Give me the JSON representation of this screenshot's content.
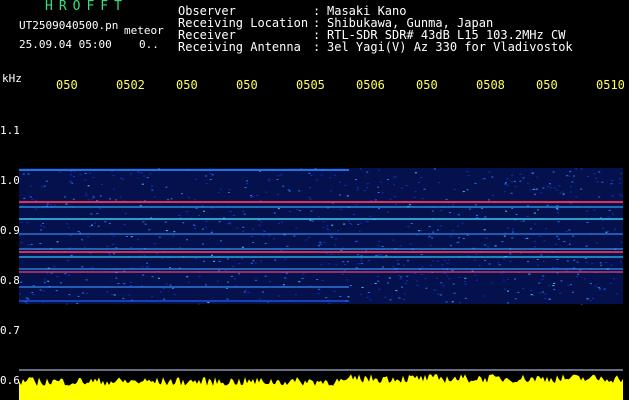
{
  "header": {
    "title": "HROFFT",
    "filename": "UT2509040500.pn",
    "mode": "meteor",
    "date_time": "25.09.04 05:00",
    "date_extra": "0..",
    "info": [
      {
        "label": "Observer",
        "value": "Masaki Kano"
      },
      {
        "label": "Receiving Location",
        "value": "Shibukawa, Gunma, Japan"
      },
      {
        "label": "Receiver",
        "value": "RTL-SDR SDR# 43dB L15 103.2MHz CW"
      },
      {
        "label": "Receiving Antenna",
        "value": "3el Yagi(V) Az 330 for Vladivostok"
      }
    ],
    "separator": ":"
  },
  "axes": {
    "y_unit": "kHz",
    "x_ticks": [
      "050",
      "0502",
      "050",
      "050",
      "0505",
      "0506",
      "050",
      "0508",
      "050",
      "0510"
    ],
    "y_ticks": [
      "1.1",
      "1.0",
      "0.9",
      "0.8",
      "0.7",
      "0.6"
    ],
    "y_range": [
      0.6,
      1.1
    ]
  },
  "colors": {
    "background": "#000000",
    "title": "#35e07a",
    "tick_labels": "#ffff55",
    "noise_floor": "#ffff00",
    "signal_low": "#0a1f8a",
    "signal_mid": "#1f7aff",
    "signal_high": "#ff3355"
  }
}
